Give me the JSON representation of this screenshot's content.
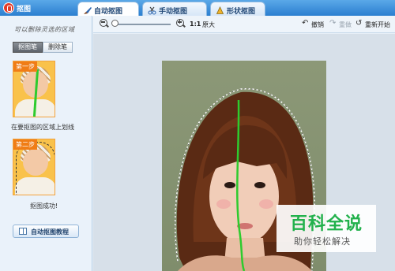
{
  "window": {
    "title": "抠图"
  },
  "tabs": [
    {
      "label": "自动抠图",
      "icon": "brush-icon",
      "active": true
    },
    {
      "label": "手动抠图",
      "icon": "scissors-icon",
      "active": false
    },
    {
      "label": "形状抠图",
      "icon": "shape-icon",
      "active": false
    }
  ],
  "left_panel": {
    "hint": "可以删除灵选的区域",
    "tool_buttons": [
      "抠图笔",
      "删除笔"
    ],
    "steps": [
      {
        "label": "第一步",
        "caption": "在要抠图的区域上划线"
      },
      {
        "label": "第二步",
        "caption": "抠图成功!"
      }
    ],
    "tutorial_button": "自动抠图教程"
  },
  "toolbar": {
    "zoom_level": "1:1",
    "enlarge_label": "原大",
    "undo_label": "撤销",
    "redo_label": "重做",
    "restart_label": "重新开始"
  },
  "watermark": {
    "logo": "百科全说",
    "subtitle": "助你轻松解决"
  },
  "colors": {
    "accent": "#2b7fd0",
    "stroke": "#2ecb2e",
    "step_badge": "#f07d16"
  }
}
